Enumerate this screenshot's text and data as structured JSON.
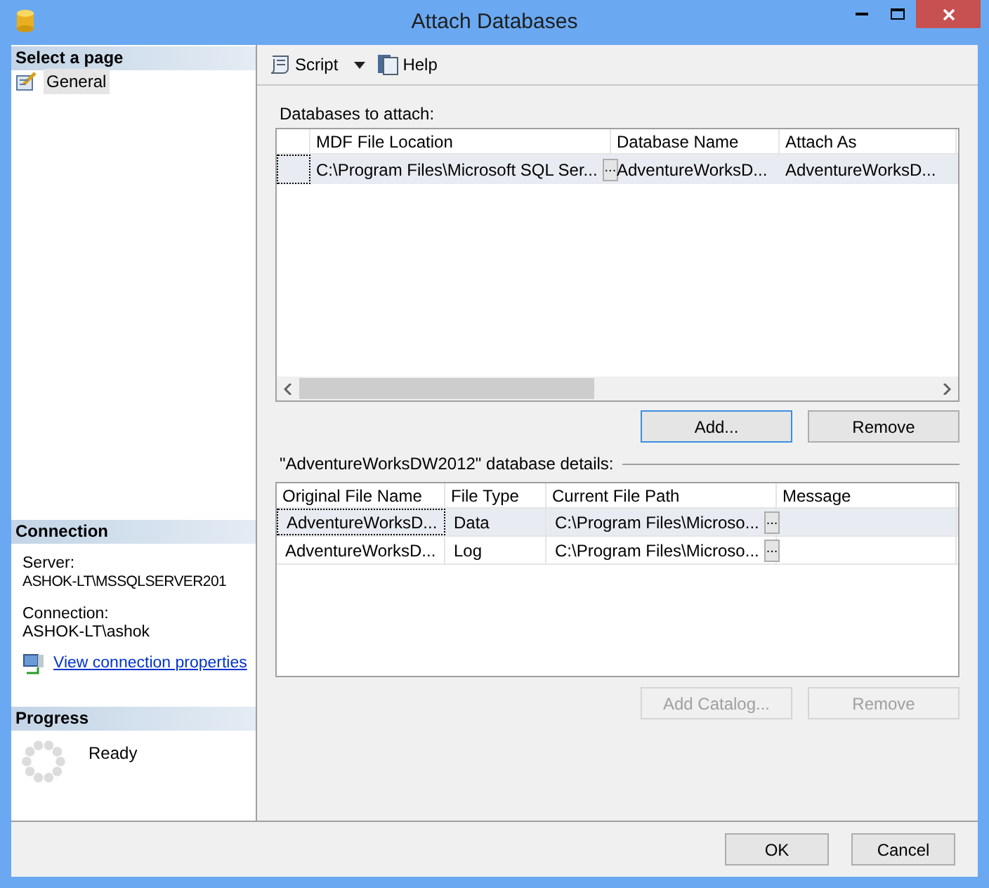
{
  "window": {
    "title": "Attach Databases"
  },
  "sidebar": {
    "header": "Select a page",
    "items": [
      {
        "label": "General",
        "selected": true
      }
    ]
  },
  "connection": {
    "header": "Connection",
    "server_label": "Server:",
    "server": "ASHOK-LT\\MSSQLSERVER201",
    "connection_label": "Connection:",
    "connection": "ASHOK-LT\\ashok",
    "link": "View connection properties"
  },
  "progress": {
    "header": "Progress",
    "status": "Ready"
  },
  "toolbar": {
    "items": [
      {
        "label": "Script",
        "kind": "script"
      },
      {
        "label": "Help",
        "kind": "help"
      }
    ]
  },
  "databases": {
    "label": "Databases to attach:",
    "columns": [
      "MDF File Location",
      "Database Name",
      "Attach As"
    ],
    "rows": [
      {
        "selected": true,
        "browse": "...",
        "cells": [
          "C:\\Program Files\\Microsoft SQL Ser...",
          "AdventureWorksD...",
          "AdventureWorksD..."
        ]
      }
    ],
    "buttons": [
      {
        "label": "Add...",
        "disabled": false,
        "focused": true
      },
      {
        "label": "Remove",
        "disabled": false,
        "focused": false
      }
    ]
  },
  "details": {
    "label": "\"AdventureWorksDW2012\" database details:",
    "columns": [
      "Original File Name",
      "File Type",
      "Current File Path",
      "Message"
    ],
    "rows": [
      {
        "selected": true,
        "browse": "...",
        "cells": [
          "AdventureWorksD...",
          "Data",
          "C:\\Program Files\\Microso...",
          ""
        ]
      },
      {
        "selected": false,
        "browse": "...",
        "cells": [
          "AdventureWorksD...",
          "Log",
          "C:\\Program Files\\Microso...",
          ""
        ]
      }
    ],
    "buttons": [
      {
        "label": "Add Catalog...",
        "disabled": true,
        "focused": false
      },
      {
        "label": "Remove",
        "disabled": true,
        "focused": false
      }
    ]
  },
  "footer": {
    "buttons": [
      {
        "label": "OK"
      },
      {
        "label": "Cancel"
      }
    ]
  }
}
